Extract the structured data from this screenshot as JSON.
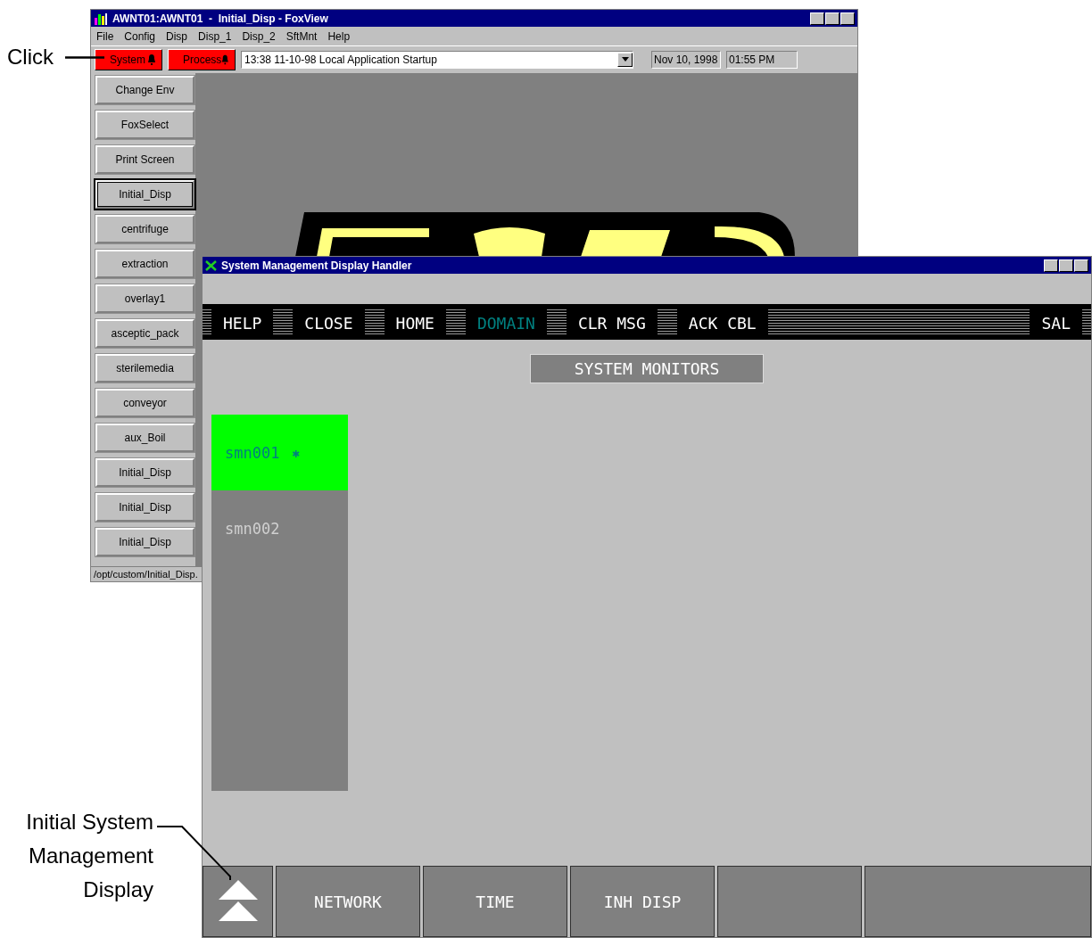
{
  "callouts": {
    "click": "Click",
    "display": "Initial System Management Display"
  },
  "back_window": {
    "title": "AWNT01:AWNT01  -  Initial_Disp - FoxView",
    "menu": [
      "File",
      "Config",
      "Disp",
      "Disp_1",
      "Disp_2",
      "SftMnt",
      "Help"
    ],
    "alarm_buttons": [
      "System",
      "Process"
    ],
    "message": "13:38 11-10-98 Local Application Startup",
    "date": "Nov 10, 1998",
    "time": "01:55 PM",
    "sidebar_buttons": [
      {
        "label": "Change Env",
        "selected": false
      },
      {
        "label": "FoxSelect",
        "selected": false
      },
      {
        "label": "Print Screen",
        "selected": false
      },
      {
        "label": "Initial_Disp",
        "selected": true
      },
      {
        "label": "centrifuge",
        "selected": false
      },
      {
        "label": "extraction",
        "selected": false
      },
      {
        "label": "overlay1",
        "selected": false
      },
      {
        "label": "asceptic_pack",
        "selected": false
      },
      {
        "label": "sterilemedia",
        "selected": false
      },
      {
        "label": "conveyor",
        "selected": false
      },
      {
        "label": "aux_Boil",
        "selected": false
      },
      {
        "label": "Initial_Disp",
        "selected": false
      },
      {
        "label": "Initial_Disp",
        "selected": false
      },
      {
        "label": "Initial_Disp",
        "selected": false
      }
    ],
    "status_path": "/opt/custom/Initial_Disp."
  },
  "front_window": {
    "title": "System Management Display Handler",
    "nav_buttons": [
      {
        "label": "HELP",
        "active": false
      },
      {
        "label": "CLOSE",
        "active": false
      },
      {
        "label": "HOME",
        "active": false
      },
      {
        "label": "DOMAIN",
        "active": true
      },
      {
        "label": "CLR MSG",
        "active": false
      },
      {
        "label": "ACK CBL",
        "active": false
      }
    ],
    "right_button": "SAL",
    "panel_title": "SYSTEM MONITORS",
    "monitors": [
      {
        "name": "smn001",
        "marker": "✱",
        "selected": true
      },
      {
        "name": "smn002",
        "selected": false
      }
    ],
    "bottom_buttons": [
      "NETWORK",
      "TIME",
      "INH DISP"
    ]
  }
}
